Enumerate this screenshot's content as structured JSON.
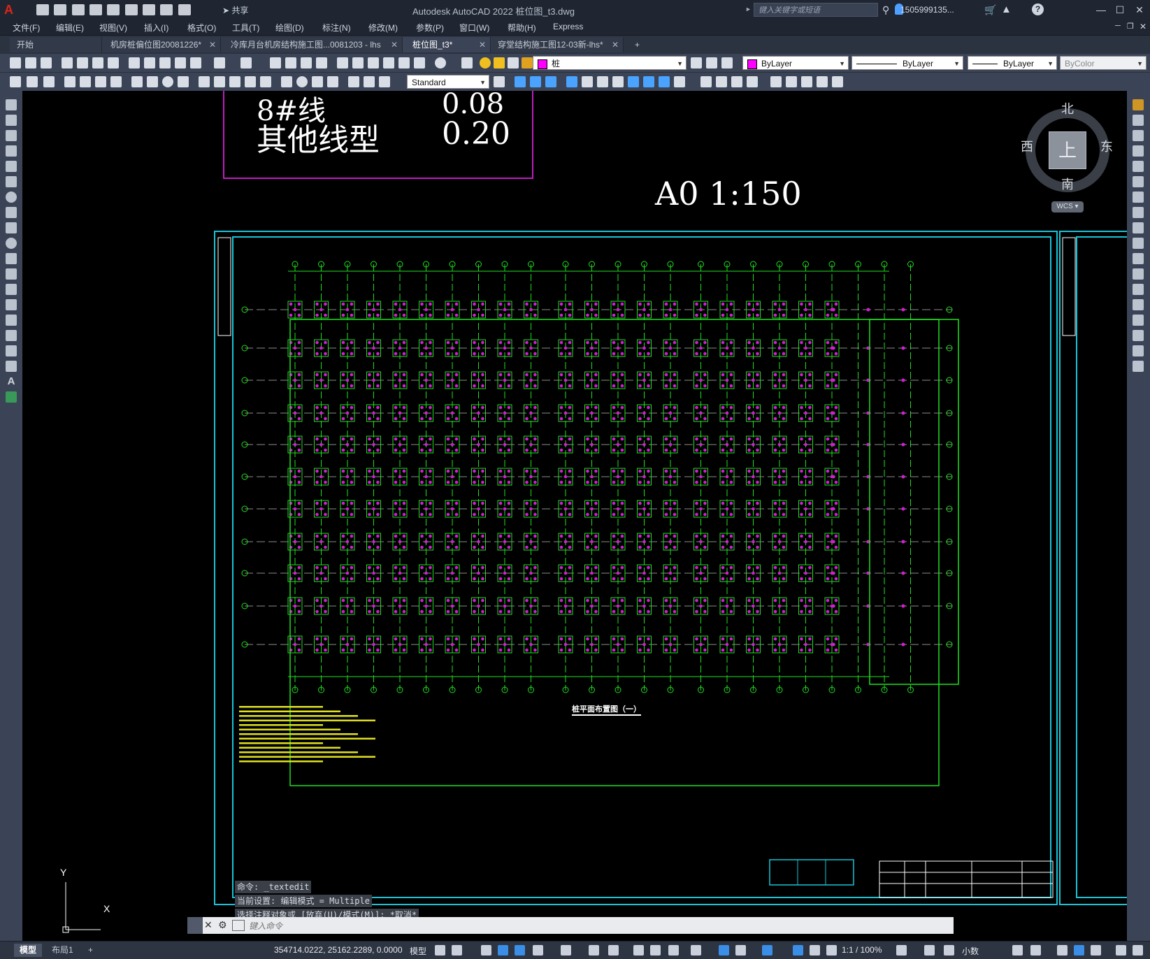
{
  "app": {
    "logo": "A",
    "window_title": "Autodesk AutoCAD 2022    桩位图_t3.dwg",
    "share_label": "共享",
    "search_placeholder": "键入关键字或短语",
    "user": "1505999135...",
    "minimize": "—",
    "restore": "☐",
    "close": "✕"
  },
  "menu": [
    "文件(F)",
    "编辑(E)",
    "视图(V)",
    "插入(I)",
    "格式(O)",
    "工具(T)",
    "绘图(D)",
    "标注(N)",
    "修改(M)",
    "参数(P)",
    "窗口(W)",
    "帮助(H)",
    "Express"
  ],
  "tabs": [
    {
      "label": "开始",
      "closable": false,
      "active": false
    },
    {
      "label": "机房桩偏位图20081226*",
      "closable": true,
      "active": false
    },
    {
      "label": "冷库月台机房结构施工图...0081203 - lhs",
      "closable": true,
      "active": false
    },
    {
      "label": "桩位图_t3*",
      "closable": true,
      "active": true
    },
    {
      "label": "穿堂结构施工图12-03新-lhs*",
      "closable": true,
      "active": false
    }
  ],
  "new_tab": "+",
  "properties": {
    "layer": "桩",
    "color": "ByLayer",
    "linetype": "ByLayer",
    "lineweight": "ByLayer",
    "plotstyle": "ByColor",
    "text_style": "Standard"
  },
  "drawing": {
    "legend_row_1_name": "8#线",
    "legend_row_1_value": "0.08",
    "legend_row_2_name": "其他线型",
    "legend_row_2_value": "0.20",
    "scale": "A0  1:150",
    "plan_title": "桩平面布置图（一）",
    "colors": {
      "frame": "#19c3d6",
      "grid": "#1ee01e",
      "piles": "#d41cd4",
      "notes": "#e0e020"
    }
  },
  "viewcube": {
    "north": "北",
    "south": "南",
    "east": "东",
    "west": "西",
    "face": "上",
    "wcs": "WCS"
  },
  "ucs": {
    "x": "X",
    "y": "Y"
  },
  "command": {
    "history": [
      "命令: _textedit",
      "当前设置: 编辑模式 = Multiple",
      "选择注释对象或 [放弃(U)/模式(M)]: *取消*"
    ],
    "placeholder": "键入命令"
  },
  "status": {
    "model_tab": "模型",
    "layout_tab": "布局1",
    "add": "+",
    "coords": "354714.0222, 25162.2289, 0.0000",
    "space": "模型",
    "annotation_scale": "1:1 / 100%",
    "units": "小数"
  }
}
